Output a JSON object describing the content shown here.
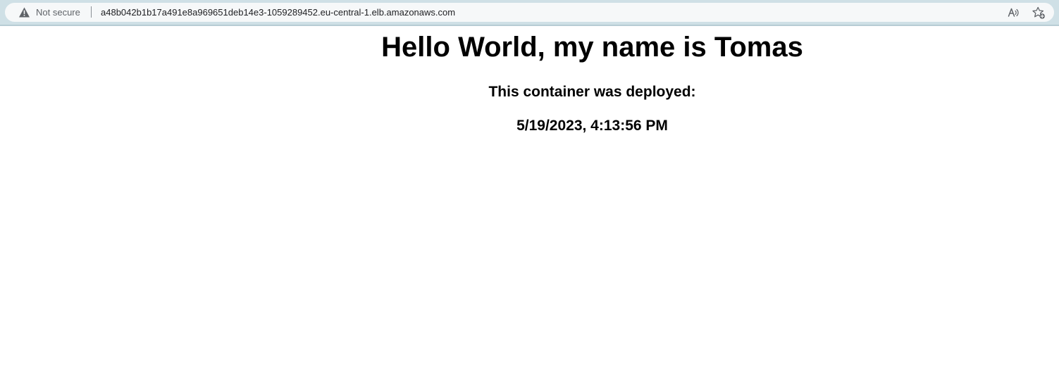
{
  "browser": {
    "security_label": "Not secure",
    "url": "a48b042b1b17a491e8a969651deb14e3-1059289452.eu-central-1.elb.amazonaws.com",
    "icons": [
      "warning-icon",
      "read-aloud-icon",
      "favorite-icon"
    ],
    "colors": {
      "chrome": "#cfe0e6",
      "address_bar": "#f6f8f9",
      "muted_text": "#5f6368"
    }
  },
  "page": {
    "heading": "Hello World, my name is Tomas",
    "deploy_label": "This container was deployed:",
    "deploy_timestamp": "5/19/2023, 4:13:56 PM"
  }
}
